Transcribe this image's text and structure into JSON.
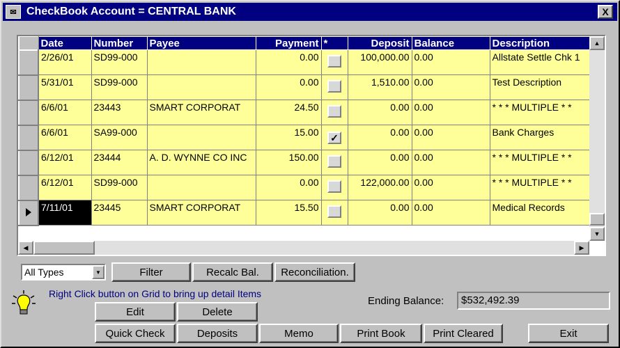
{
  "window": {
    "title": "CheckBook Account = CENTRAL BANK",
    "close_label": "X",
    "icon_label": "✉"
  },
  "grid": {
    "columns": [
      "Date",
      "Number",
      "Payee",
      "Payment",
      "*",
      "Deposit",
      "Balance",
      "Description"
    ],
    "rows": [
      {
        "date": "2/26/01",
        "number": "SD99-000",
        "payee": "",
        "payment": "0.00",
        "cleared": "",
        "deposit": "100,000.00",
        "balance": "0.00",
        "description": "Allstate Settle Chk 1"
      },
      {
        "date": "5/31/01",
        "number": "SD99-000",
        "payee": "",
        "payment": "0.00",
        "cleared": "",
        "deposit": "1,510.00",
        "balance": "0.00",
        "description": "Test Description"
      },
      {
        "date": "6/6/01",
        "number": "23443",
        "payee": "SMART CORPORAT",
        "payment": "24.50",
        "cleared": "",
        "deposit": "0.00",
        "balance": "0.00",
        "description": "* * * MULTIPLE * *"
      },
      {
        "date": "6/6/01",
        "number": "SA99-000",
        "payee": "",
        "payment": "15.00",
        "cleared": "✓",
        "deposit": "0.00",
        "balance": "0.00",
        "description": "Bank Charges"
      },
      {
        "date": "6/12/01",
        "number": "23444",
        "payee": "A. D. WYNNE CO INC",
        "payment": "150.00",
        "cleared": "",
        "deposit": "0.00",
        "balance": "0.00",
        "description": "* * * MULTIPLE * *"
      },
      {
        "date": "6/12/01",
        "number": "SD99-000",
        "payee": "",
        "payment": "0.00",
        "cleared": "",
        "deposit": "122,000.00",
        "balance": "0.00",
        "description": "* * * MULTIPLE * *"
      },
      {
        "date": "7/11/01",
        "number": "23445",
        "payee": "SMART CORPORAT",
        "payment": "15.50",
        "cleared": "",
        "deposit": "0.00",
        "balance": "0.00",
        "description": "Medical Records"
      }
    ]
  },
  "filter_bar": {
    "type_select": "All Types",
    "filter_button": "Filter",
    "recalc_button": "Recalc Bal.",
    "reconciliation_button": "Reconciliation."
  },
  "hint_text": "Right Click button on Grid to bring up detail Items",
  "ending_balance": {
    "label": "Ending Balance:",
    "value": "$532,492.39"
  },
  "buttons": {
    "edit": "Edit",
    "delete": "Delete",
    "quick_check": "Quick Check",
    "deposits": "Deposits",
    "memo": "Memo",
    "print_book": "Print Book",
    "print_cleared": "Print Cleared",
    "exit": "Exit"
  }
}
